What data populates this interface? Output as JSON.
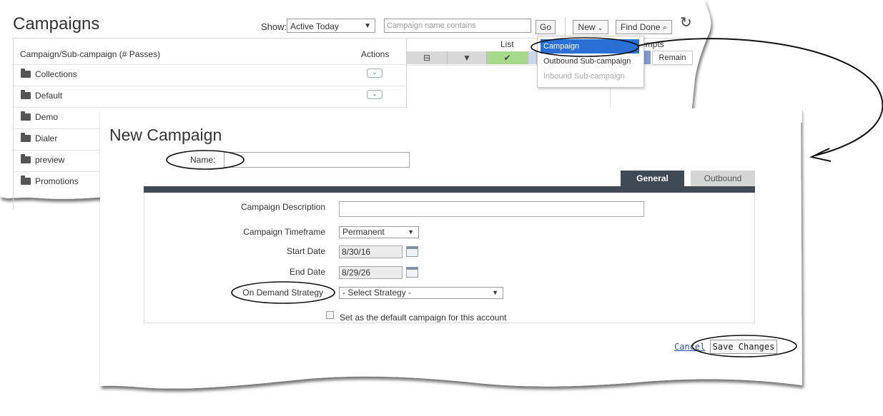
{
  "campaigns": {
    "title": "Campaigns",
    "show_label": "Show:",
    "show_value": "Active Today",
    "search_placeholder": "Campaign name contains",
    "go_label": "Go",
    "new_label": "New",
    "find_done_label": "Find Done",
    "column_campaign": "Campaign/Sub-campaign (# Passes)",
    "column_actions": "Actions",
    "column_list": "List",
    "column_attempts": "empts",
    "column_remain": "Remain",
    "rows": [
      "Collections",
      "Default",
      "Demo",
      "Dialer",
      "preview",
      "Promotions"
    ],
    "new_menu": {
      "items": [
        "Campaign",
        "Outbound Sub-campaign",
        "Inbound Sub-campaign"
      ],
      "selected": "Campaign"
    }
  },
  "new_campaign": {
    "title": "New Campaign",
    "name_label": "Name:",
    "name_value": "",
    "tabs": [
      "General",
      "Outbound"
    ],
    "active_tab": "General",
    "description_label": "Campaign Description",
    "timeframe_label": "Campaign Timeframe",
    "timeframe_value": "Permanent",
    "start_date_label": "Start Date",
    "start_date_value": "8/30/16",
    "end_date_label": "End Date",
    "end_date_value": "8/29/26",
    "strategy_label": "On Demand Strategy",
    "strategy_value": "- Select Strategy -",
    "default_checkbox_label": "Set as the default campaign for this account",
    "cancel_label": "Cancel",
    "save_label": "Save Changes"
  },
  "colors": {
    "tab_active": "#404a54",
    "menu_selected": "#2a6fd6",
    "list_header_green": "#a6d98a"
  }
}
